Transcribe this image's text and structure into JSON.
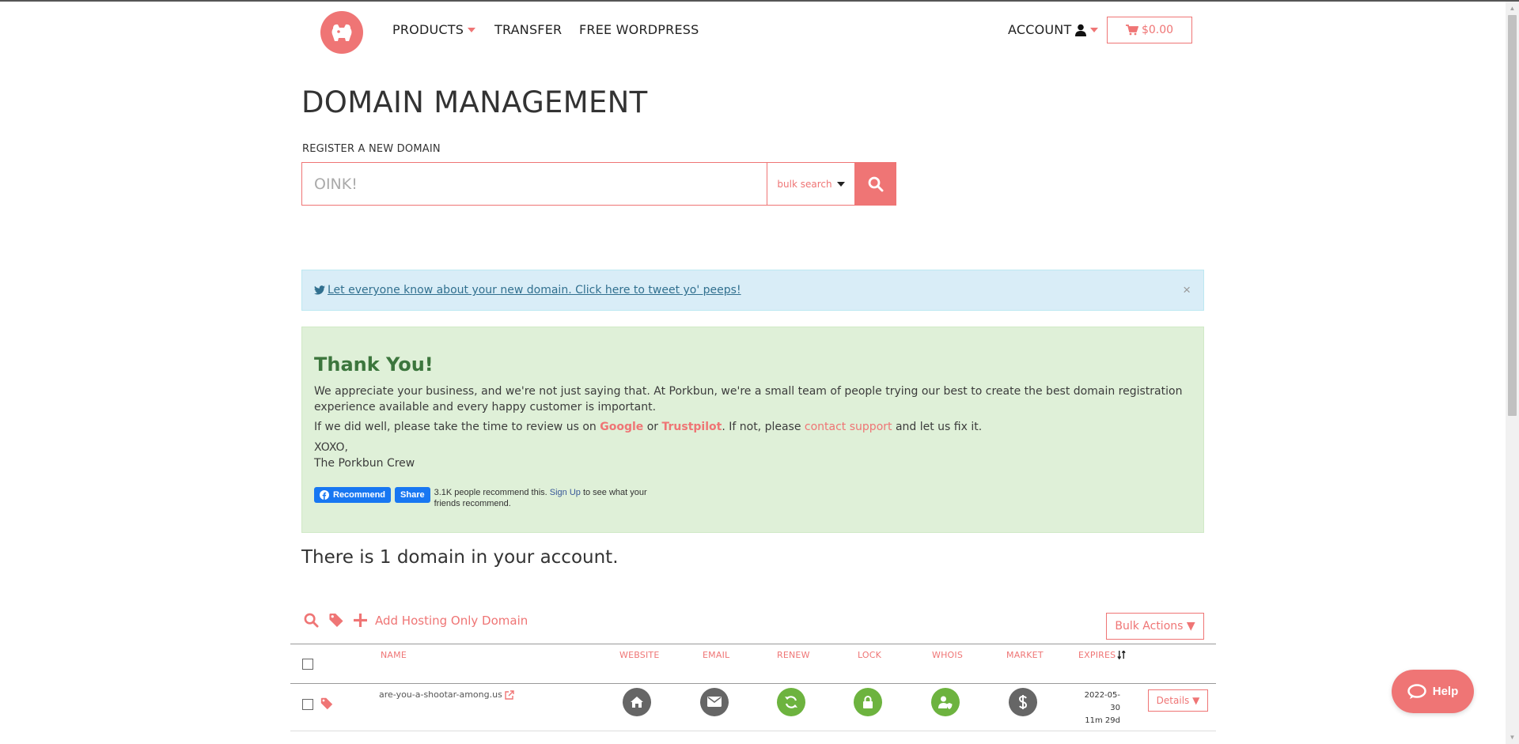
{
  "header": {
    "nav": {
      "products": "PRODUCTS",
      "transfer": "TRANSFER",
      "free_wordpress": "FREE WORDPRESS",
      "account": "ACCOUNT"
    },
    "cart_total": "$0.00"
  },
  "page": {
    "title": "DOMAIN MANAGEMENT",
    "register_label": "REGISTER A NEW DOMAIN",
    "search_placeholder": "OINK!",
    "bulk_search_label": "bulk search"
  },
  "tweet_alert": {
    "text": "Let everyone know about your new domain. Click here to tweet yo' peeps!",
    "close": "×"
  },
  "thank_you": {
    "heading": "Thank You!",
    "p1": "We appreciate your business, and we're not just saying that. At Porkbun, we're a small team of people trying our best to create the best domain registration experience available and every happy customer is important.",
    "p2_start": "If we did well, please take the time to review us on ",
    "google": "Google",
    "or": " or ",
    "trustpilot": "Trustpilot",
    "p2_mid": ". If not, please ",
    "contact_support": "contact support",
    "p2_end": " and let us fix it.",
    "sign1": "XOXO,",
    "sign2": "The Porkbun Crew",
    "fb_recommend": "Recommend",
    "fb_share": "Share",
    "fb_text_start": "3.1K people recommend this. ",
    "fb_signup": "Sign Up",
    "fb_text_end": " to see what your friends recommend."
  },
  "domain_count_text": "There is 1 domain in your account.",
  "toolbar": {
    "add_hosting": "Add Hosting Only Domain",
    "bulk_actions": "Bulk Actions ▼"
  },
  "table": {
    "headers": {
      "name": "NAME",
      "website": "WEBSITE",
      "email": "EMAIL",
      "renew": "RENEW",
      "lock": "LOCK",
      "whois": "WHOIS",
      "market": "MARKET",
      "expires": "EXPIRES"
    },
    "rows": [
      {
        "name": "are-you-a-shootar-among.us",
        "expires_date": "2022-05-30",
        "expires_remaining": "11m 29d",
        "details": "Details ▼"
      }
    ]
  },
  "help_label": "Help",
  "colors": {
    "brand": "#ef7575",
    "success_bg": "#dff0d8",
    "info_bg": "#d9edf7",
    "green_icon": "#6db33f",
    "gray_icon": "#666666"
  },
  "icons": [
    "pig-logo-icon",
    "user-icon",
    "cart-icon",
    "search-icon",
    "twitter-icon",
    "facebook-icon",
    "tag-icon",
    "plus-icon",
    "external-link-icon",
    "home-icon",
    "envelope-icon",
    "refresh-icon",
    "lock-icon",
    "user-shield-icon",
    "dollar-icon",
    "sort-icon",
    "chat-bubble-icon"
  ]
}
